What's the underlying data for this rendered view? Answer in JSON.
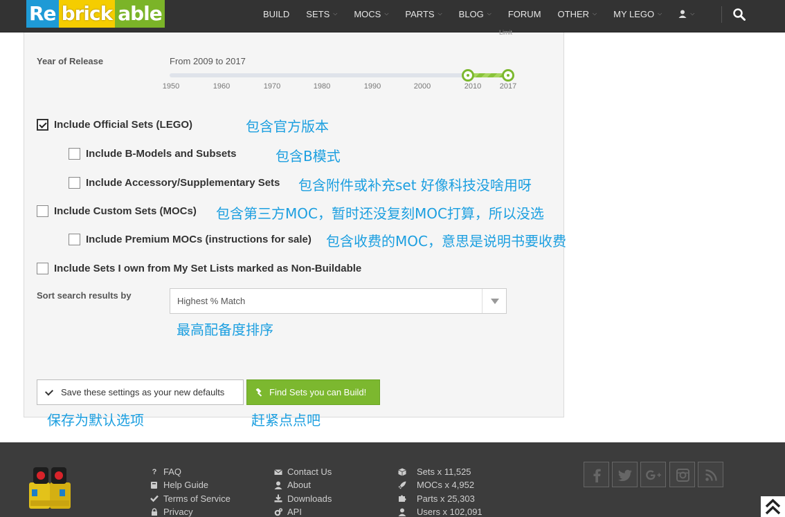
{
  "nav": {
    "logo": [
      "Re",
      "brick",
      "able"
    ],
    "items": [
      {
        "label": "BUILD",
        "dropdown": false
      },
      {
        "label": "SETS",
        "dropdown": true
      },
      {
        "label": "MOCS",
        "dropdown": true
      },
      {
        "label": "PARTS",
        "dropdown": true
      },
      {
        "label": "BLOG",
        "dropdown": true
      },
      {
        "label": "FORUM",
        "dropdown": false
      },
      {
        "label": "OTHER",
        "dropdown": true
      },
      {
        "label": "MY LEGO",
        "dropdown": true
      }
    ],
    "user_icon": "user-icon",
    "search_icon": "search-icon"
  },
  "filters": {
    "limit_label": "Limit",
    "year": {
      "label": "Year of Release",
      "range_text": "From 2009 to 2017",
      "ticks": [
        "1950",
        "1960",
        "1970",
        "1980",
        "1990",
        "2000",
        "2010",
        "2017"
      ],
      "from": 2009,
      "to": 2017,
      "min": 1950,
      "max": 2017
    },
    "checkboxes": [
      {
        "label": "Include Official Sets (LEGO)",
        "checked": true,
        "note": "包含官方版本"
      },
      {
        "label": "Include B-Models and Subsets",
        "checked": false,
        "note": "包含B模式"
      },
      {
        "label": "Include Accessory/Supplementary Sets",
        "checked": false,
        "note": "包含附件或补充set  好像科技没啥用呀"
      },
      {
        "label": "Include Custom Sets (MOCs)",
        "checked": false,
        "note": "包含第三方MOC，暂时还没复刻MOC打算，所以没选"
      },
      {
        "label": "Include Premium MOCs (instructions for sale)",
        "checked": false,
        "note": "包含收费的MOC，意思是说明书要收费"
      },
      {
        "label": "Include Sets I own from My Set Lists marked as Non-Buildable",
        "checked": false,
        "note": ""
      }
    ],
    "sort": {
      "label": "Sort search results by",
      "value": "Highest % Match",
      "note": "最高配备度排序"
    }
  },
  "actions": {
    "save_label": "Save these settings as your new defaults",
    "save_note": "保存为默认选项",
    "find_label": "Find Sets you can Build!",
    "find_note": "赶紧点点吧"
  },
  "footer": {
    "col1": [
      "FAQ",
      "Help Guide",
      "Terms of Service",
      "Privacy"
    ],
    "col2": [
      "Contact Us",
      "About",
      "Downloads",
      "API"
    ],
    "stats": [
      "Sets x 11,525",
      "MOCs x 4,952",
      "Parts x 25,303",
      "Users x 102,091"
    ],
    "social": [
      "facebook-icon",
      "twitter-icon",
      "google-plus-icon",
      "instagram-icon",
      "rss-icon"
    ]
  },
  "colors": {
    "accent": "#7cb82f",
    "note": "#1c9fe0",
    "nav_bg": "#333333",
    "footer_bg": "#3c3c3c"
  }
}
